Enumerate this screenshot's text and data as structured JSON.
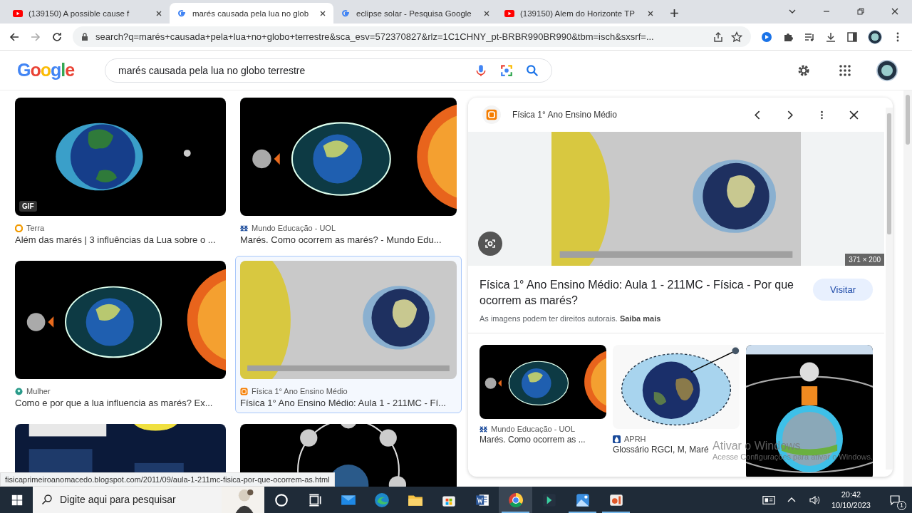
{
  "browser": {
    "tabs": [
      {
        "title": "(139150) A possible cause f",
        "selected": false
      },
      {
        "title": "marés causada pela lua no glob",
        "selected": true
      },
      {
        "title": "eclipse solar - Pesquisa Google",
        "selected": false
      },
      {
        "title": "(139150) Alem do Horizonte TP",
        "selected": false
      }
    ],
    "address": "search?q=marés+causada+pela+lua+no+globo+terrestre&sca_esv=572370827&rlz=1C1CHNY_pt-BRBR990BR990&tbm=isch&sxsrf=..."
  },
  "search_header": {
    "logo": "Google",
    "query": "marés causada pela lua no globo terrestre"
  },
  "results": [
    {
      "source": "Terra",
      "title": "Além das marés | 3 influências da Lua sobre o ...",
      "badge": "GIF",
      "selected": false
    },
    {
      "source": "Mundo Educação - UOL",
      "title": "Marés. Como ocorrem as marés? - Mundo Edu...",
      "selected": false
    },
    {
      "source": "Mulher",
      "title": "Como e por que a lua influencia as marés? Ex...",
      "selected": false
    },
    {
      "source": "Física 1° Ano Ensino Médio",
      "title": "Física 1° Ano Ensino Médio: Aula 1 - 211MC - Fí...",
      "selected": true
    }
  ],
  "more_results": [
    {
      "kind": "picture"
    },
    {
      "kind": "picture"
    }
  ],
  "preview": {
    "source": "Física 1° Ano Ensino Médio",
    "size": "371 × 200",
    "title": "Física 1° Ano Ensino Médio: Aula 1 - 211MC - Física - Por que ocorrem as marés?",
    "visit": "Visitar",
    "notice": "As imagens podem ter direitos autorais. **Saiba mais**",
    "related": [
      {
        "source": "Mundo Educação - UOL",
        "title": "Marés. Como ocorrem as ..."
      },
      {
        "source": "APRH",
        "title": "Glossário RGCI, M, Maré"
      },
      {
        "kind": "picture"
      }
    ]
  },
  "status_url": "fisicaprimeiroanomacedo.blogspot.com/2011/09/aula-1-211mc-fisica-por-que-ocorrem-as.html",
  "activation": {
    "title": "Ativar o Windows",
    "text": "Acesse Configurações para ativar o Windows."
  },
  "taskbar": {
    "search_placeholder": "Digite aqui para pesquisar",
    "apps": [
      {
        "running": false,
        "active": false
      },
      {
        "running": false,
        "active": false
      },
      {
        "running": false,
        "active": false
      },
      {
        "running": false,
        "active": false
      },
      {
        "running": false,
        "active": false
      },
      {
        "running": false,
        "active": false
      },
      {
        "running": false,
        "active": false
      },
      {
        "running": true,
        "active": true
      },
      {
        "running": false,
        "active": false
      },
      {
        "running": true,
        "active": false
      },
      {
        "running": true,
        "active": false
      }
    ],
    "time": "20:42",
    "date": "10/10/2023",
    "notifications": "1"
  }
}
